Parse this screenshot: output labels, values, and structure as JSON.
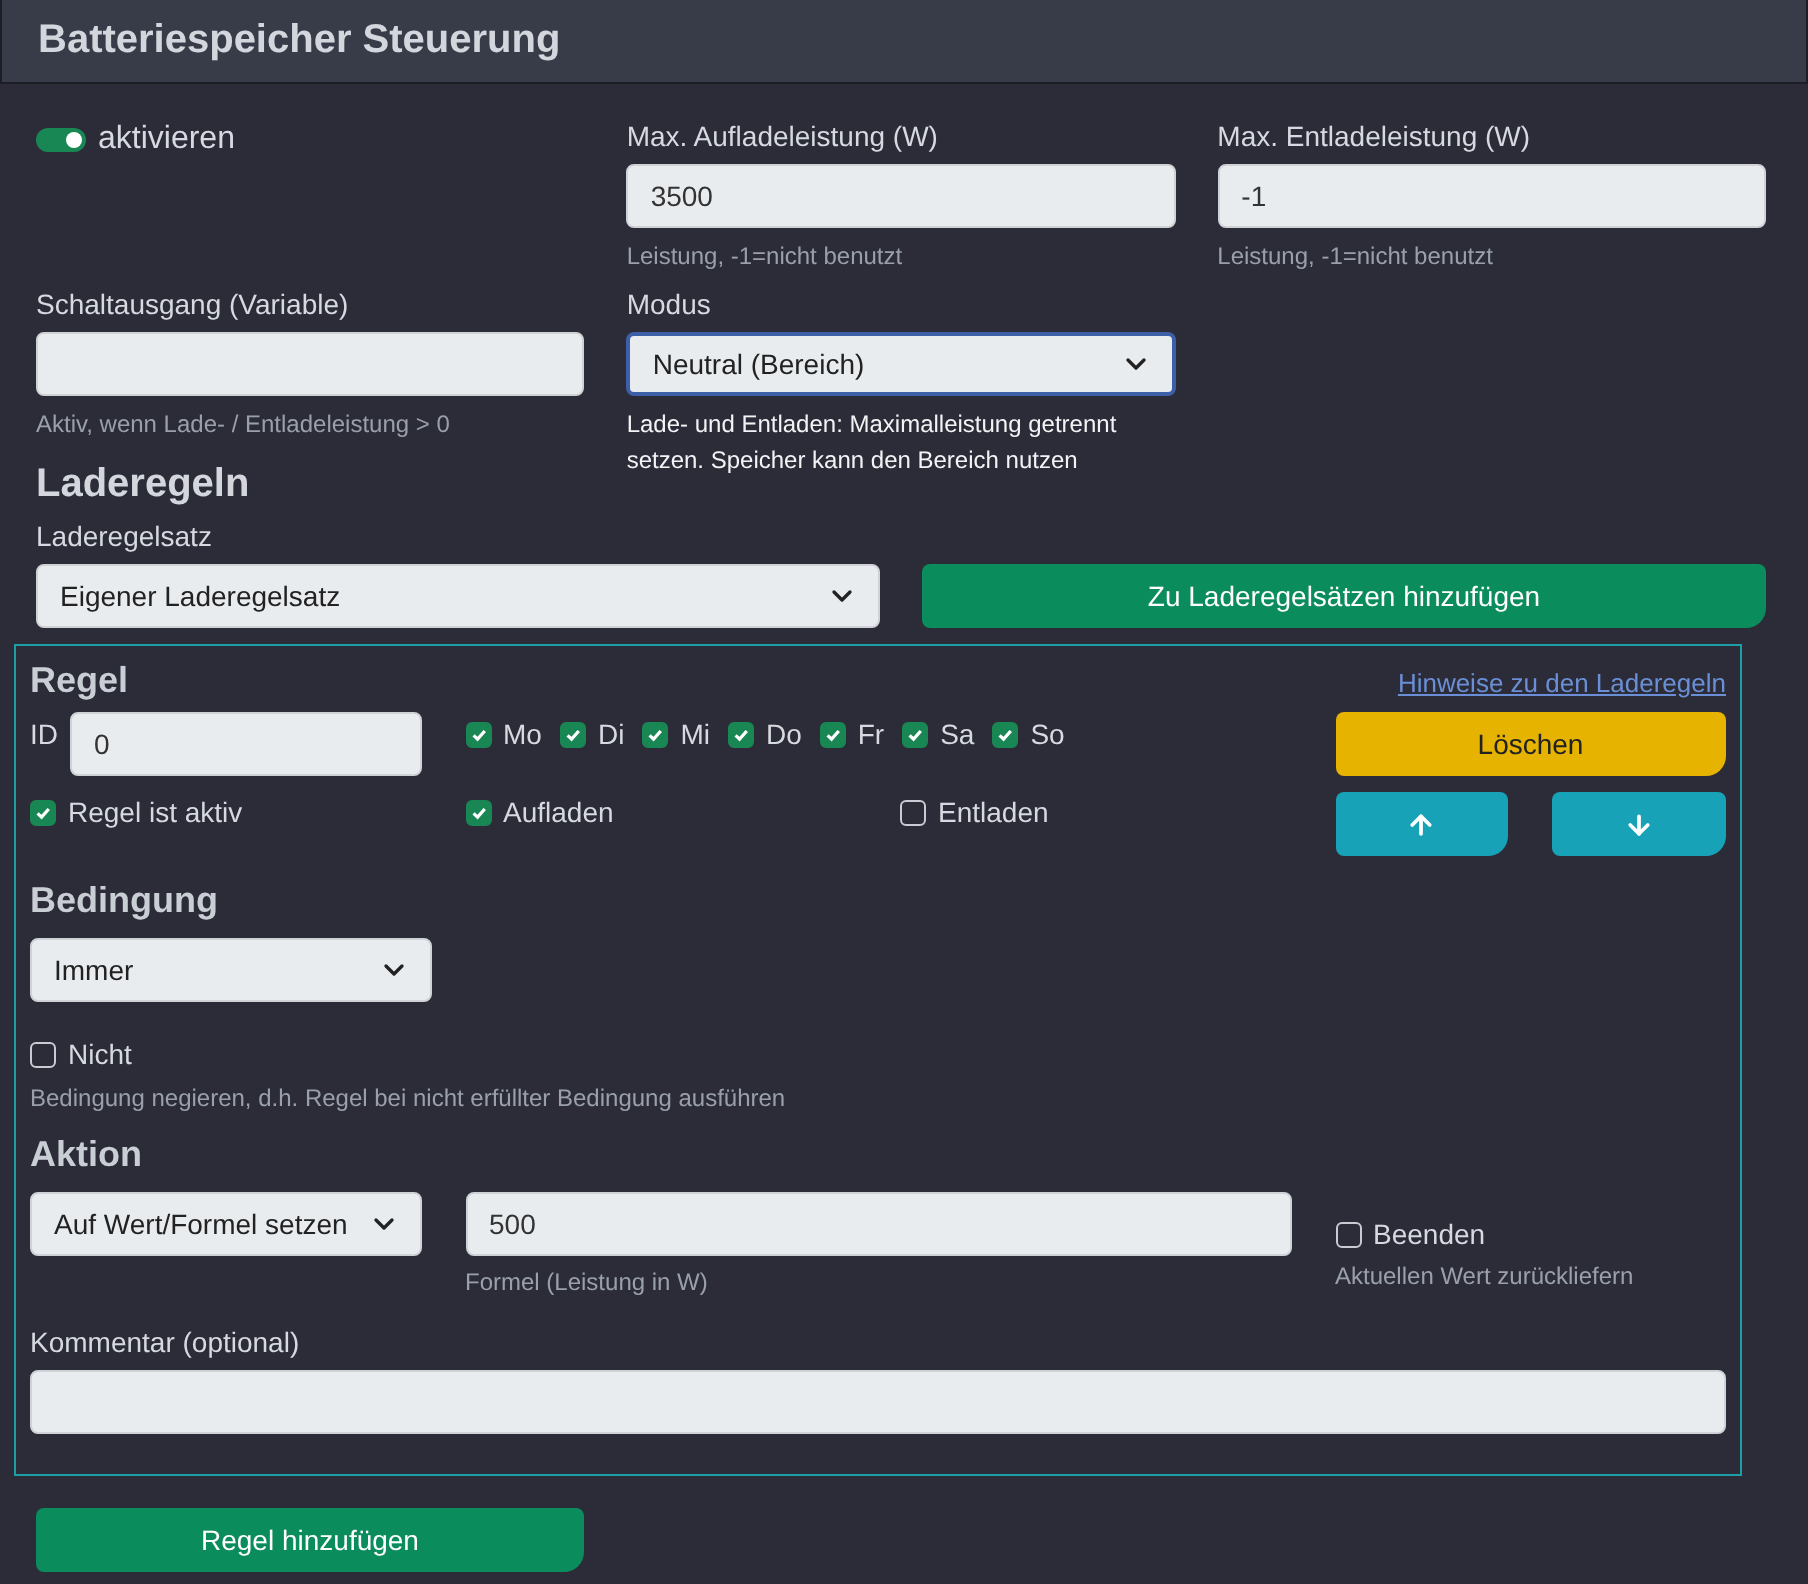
{
  "title": "Batteriespeicher Steuerung",
  "enable": {
    "label": "aktivieren",
    "on": true
  },
  "max_charge": {
    "label": "Max. Aufladeleistung (W)",
    "value": "3500",
    "help": "Leistung, -1=nicht benutzt"
  },
  "max_discharge": {
    "label": "Max. Entladeleistung (W)",
    "value": "-1",
    "help": "Leistung, -1=nicht benutzt"
  },
  "switch_output": {
    "label": "Schaltausgang (Variable)",
    "help": "Aktiv, wenn Lade- / Entladeleistung > 0"
  },
  "mode": {
    "label": "Modus",
    "value": "Neutral (Bereich)",
    "focused": true,
    "help": "Lade- und Entladen: Maximalleistung getrennt setzen. Speicher kann den Bereich nutzen"
  },
  "rules_heading": "Laderegeln",
  "ruleset": {
    "label": "Laderegelsatz",
    "value": "Eigener Laderegelsatz"
  },
  "add_to_rulesets_button": "Zu Laderegelsätzen hinzufügen",
  "rule": {
    "heading": "Regel",
    "hint_link": "Hinweise zu den Laderegeln",
    "id_label": "ID",
    "id_value": "0",
    "days": [
      {
        "label": "Mo",
        "checked": true
      },
      {
        "label": "Di",
        "checked": true
      },
      {
        "label": "Mi",
        "checked": true
      },
      {
        "label": "Do",
        "checked": true
      },
      {
        "label": "Fr",
        "checked": true
      },
      {
        "label": "Sa",
        "checked": true
      },
      {
        "label": "So",
        "checked": true
      }
    ],
    "active": {
      "label": "Regel ist aktiv",
      "checked": true
    },
    "charge": {
      "label": "Aufladen",
      "checked": true
    },
    "discharge": {
      "label": "Entladen",
      "checked": false
    },
    "delete_button": "Löschen",
    "condition_heading": "Bedingung",
    "condition": {
      "value": "Immer"
    },
    "negate": {
      "label": "Nicht",
      "checked": false,
      "help": "Bedingung negieren, d.h. Regel bei nicht erfüllter Bedingung ausführen"
    },
    "action_heading": "Aktion",
    "action": {
      "value": "Auf Wert/Formel setzen"
    },
    "formula": {
      "value": "500",
      "help": "Formel (Leistung in W)"
    },
    "finish": {
      "label": "Beenden",
      "checked": false,
      "help": "Aktuellen Wert zurückliefern"
    },
    "comment": {
      "label": "Kommentar (optional)"
    }
  },
  "add_rule_button": "Regel hinzufügen"
}
